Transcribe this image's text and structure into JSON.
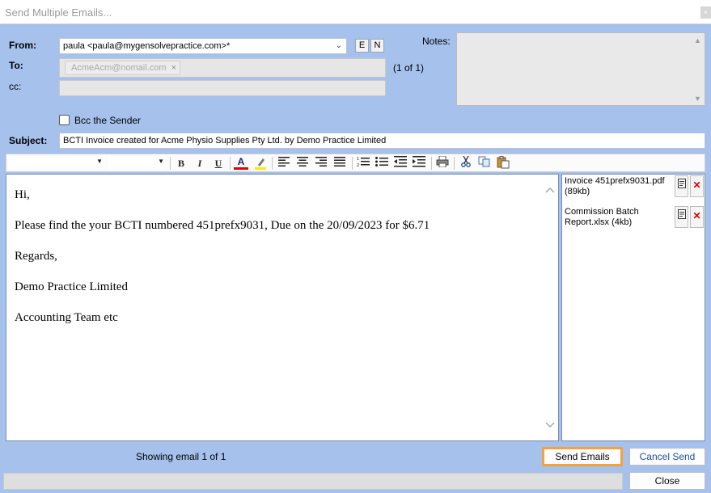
{
  "window": {
    "title": "Send Multiple Emails...",
    "close_glyph": "×"
  },
  "from": {
    "label": "From:",
    "value": "paula <paula@mygensolvepractice.com>*",
    "btn_e": "E",
    "btn_n": "N"
  },
  "to": {
    "label": "To:",
    "chip": "AcmeAcm@nomail.com",
    "chip_remove": "×",
    "count": "(1 of 1)"
  },
  "cc": {
    "label": "cc:",
    "value": ""
  },
  "notes": {
    "label": "Notes:",
    "value": ""
  },
  "bcc": {
    "label": "Bcc the Sender",
    "checked": false
  },
  "subject": {
    "label": "Subject:",
    "value": "BCTI Invoice created for  Acme Physio Supplies Pty Ltd. by  Demo Practice Limited"
  },
  "toolbar": {
    "bold": "B",
    "italic": "I",
    "underline": "U",
    "font_color": "A",
    "icons": [
      "dropdown-arrow-icon",
      "bold-icon",
      "italic-icon",
      "underline-icon",
      "font-color-icon",
      "highlight-icon",
      "align-left-icon",
      "align-center-icon",
      "align-right-icon",
      "justify-icon",
      "numbered-list-icon",
      "bullet-list-icon",
      "outdent-icon",
      "indent-icon",
      "print-icon",
      "cut-icon",
      "copy-icon",
      "paste-icon"
    ]
  },
  "body": {
    "lines": [
      "Hi,",
      "Please find the your BCTI numbered 451prefx9031, Due on the 20/09/2023 for $6.71",
      "Regards,",
      "Demo Practice Limited",
      "Accounting Team etc"
    ]
  },
  "attachments": [
    {
      "name": "Invoice 451prefx9031.pdf (89kb)"
    },
    {
      "name": "Commission Batch Report.xlsx (4kb)"
    }
  ],
  "footer": {
    "status": "Showing email   1 of 1"
  },
  "buttons": {
    "send": "Send Emails",
    "cancel": "Cancel Send",
    "close": "Close"
  },
  "colors": {
    "background": "#a5c1ec",
    "send_highlight": "#f4a23a",
    "delete_red": "#e00000",
    "cancel_blue": "#1f4e9a"
  }
}
